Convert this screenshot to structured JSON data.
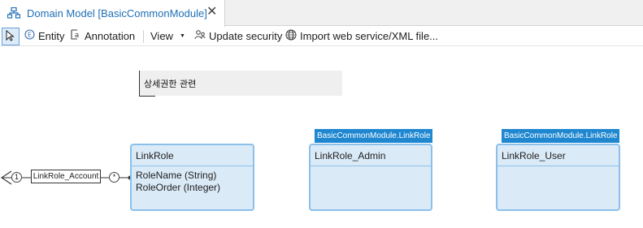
{
  "tab": {
    "title": "Domain Model [BasicCommonModule]",
    "close_glyph": "✕",
    "icon": "domain-model-icon"
  },
  "toolbar": {
    "select_icon": "pointer-select-icon",
    "entity_label": "Entity",
    "annotation_label": "Annotation",
    "view_label": "View",
    "update_security_label": "Update security",
    "import_label": "Import web service/XML file..."
  },
  "annotation": {
    "text": "상세권한 관련"
  },
  "entities": [
    {
      "name": "LinkRole",
      "attributes": [
        "RoleName (String)",
        "RoleOrder (Integer)"
      ]
    },
    {
      "name": "LinkRole_Admin",
      "generalization": "BasicCommonModule.LinkRole",
      "attributes": []
    },
    {
      "name": "LinkRole_User",
      "generalization": "BasicCommonModule.LinkRole",
      "attributes": []
    }
  ],
  "association": {
    "name": "LinkRole_Account",
    "left_multiplicity": "1",
    "right_multiplicity": "*"
  },
  "colors": {
    "entity_fill": "#daeaf7",
    "entity_border": "#8cc0ea",
    "generalization_label": "#1f87d0",
    "tab_title": "#1f6fb5"
  }
}
